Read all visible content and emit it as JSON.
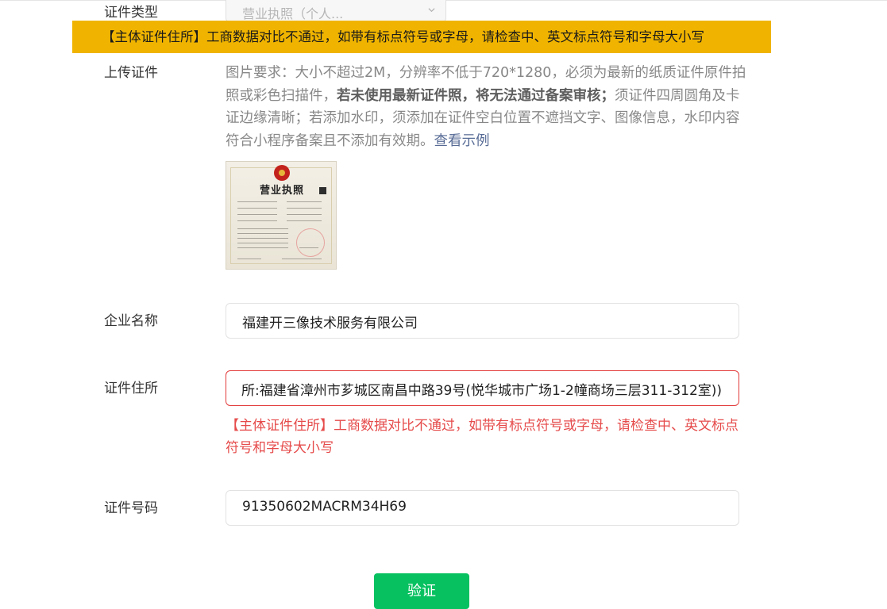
{
  "toast": {
    "message": "【主体证件住所】工商数据对比不通过，如带有标点符号或字母，请检查中、英文标点符号和字母大小写"
  },
  "form": {
    "cert_type": {
      "label": "证件类型",
      "value": "营业执照（个人..."
    },
    "upload": {
      "label": "上传证件",
      "req_part1": "图片要求：大小不超过2M，分辨率不低于720*1280，必须为最新的纸质证件原件拍照或彩色扫描件，",
      "req_bold": "若未使用最新证件照，将无法通过备案审核；",
      "req_part2": "须证件四周圆角及卡证边缘清晰；若添加水印，须添加在证件空白位置不遮挡文字、图像信息，水印内容符合小程序备案且不添加有效期。",
      "example_link": "查看示例",
      "sample_title": "营业执照"
    },
    "company_name": {
      "label": "企业名称",
      "value": "福建开三像技术服务有限公司"
    },
    "address": {
      "label": "证件住所",
      "value": "所:福建省漳州市芗城区南昌中路39号(悦华城市广场1-2幢商场三层311-312室))",
      "error": "【主体证件住所】工商数据对比不通过，如带有标点符号或字母，请检查中、英文标点符号和字母大小写"
    },
    "cert_number": {
      "label": "证件号码",
      "value": "91350602MACRM34H69"
    }
  },
  "actions": {
    "verify_label": "验证"
  },
  "colors": {
    "toast_bg": "#f0b400",
    "error": "#e64b4b",
    "primary_button": "#07c160",
    "link": "#576b95"
  }
}
